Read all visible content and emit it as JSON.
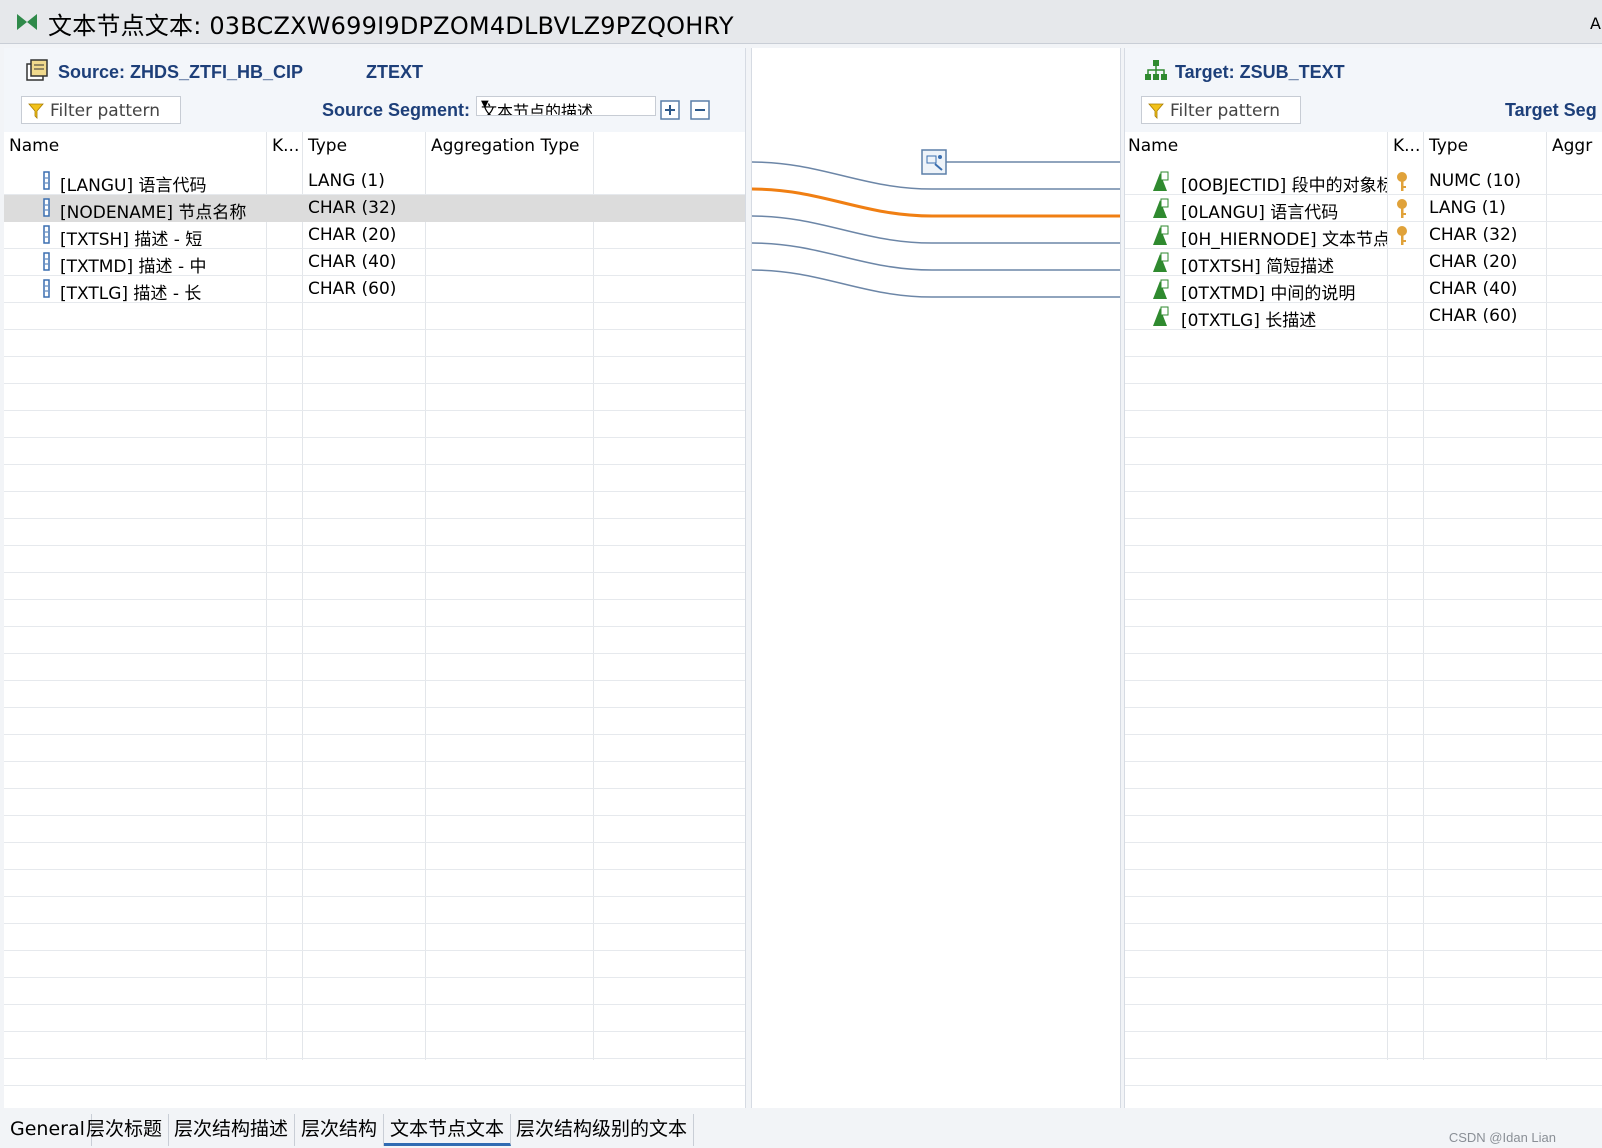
{
  "window": {
    "title": "文本节点文本: 03BCZXW699I9DPZOM4DLBVLZ9PZQOHRY",
    "right_cut_label": "A"
  },
  "source": {
    "title": "Source: ZHDS_ZTFI_HB_CIP",
    "segment_name": "ZTEXT",
    "filter_placeholder": "Filter pattern",
    "segment_label": "Source Segment:",
    "segment_value": "文本节点的描述",
    "columns": [
      "Name",
      "K...",
      "Type",
      "Aggregation Type"
    ],
    "rows": [
      {
        "name": "[LANGU] 语言代码",
        "key": "",
        "type": "LANG (1)",
        "agg": ""
      },
      {
        "name": "[NODENAME] 节点名称",
        "key": "",
        "type": "CHAR (32)",
        "agg": "",
        "selected": true
      },
      {
        "name": "[TXTSH] 描述 - 短",
        "key": "",
        "type": "CHAR (20)",
        "agg": ""
      },
      {
        "name": "[TXTMD] 描述 - 中",
        "key": "",
        "type": "CHAR (40)",
        "agg": ""
      },
      {
        "name": "[TXTLG] 描述 - 长",
        "key": "",
        "type": "CHAR (60)",
        "agg": ""
      }
    ]
  },
  "target": {
    "title": "Target: ZSUB_TEXT",
    "filter_placeholder": "Filter pattern",
    "segment_label": "Target Seg",
    "columns": [
      "Name",
      "K...",
      "Type",
      "Aggr"
    ],
    "rows": [
      {
        "name": "[0OBJECTID] 段中的对象标",
        "key": true,
        "type": "NUMC (10)"
      },
      {
        "name": "[0LANGU] 语言代码",
        "key": true,
        "type": "LANG (1)"
      },
      {
        "name": "[0H_HIERNODE] 文本节点",
        "key": true,
        "type": "CHAR (32)"
      },
      {
        "name": "[0TXTSH] 简短描述",
        "key": false,
        "type": "CHAR (20)"
      },
      {
        "name": "[0TXTMD] 中间的说明",
        "key": false,
        "type": "CHAR (40)"
      },
      {
        "name": "[0TXTLG] 长描述",
        "key": false,
        "type": "CHAR (60)"
      }
    ]
  },
  "mapping": {
    "line_color": "#6c86a7",
    "highlight_color": "#f07f13",
    "links": [
      {
        "from": "[LANGU] 语言代码",
        "to": "[0LANGU] 语言代码",
        "highlight": false
      },
      {
        "from": "[NODENAME] 节点名称",
        "to": "[0H_HIERNODE] 文本节点",
        "highlight": true
      },
      {
        "from": "[TXTSH] 描述 - 短",
        "to": "[0TXTSH] 简短描述",
        "highlight": false
      },
      {
        "from": "[TXTMD] 描述 - 中",
        "to": "[0TXTMD] 中间的说明",
        "highlight": false
      },
      {
        "from": "[TXTLG] 描述 - 长",
        "to": "[0TXTLG] 长描述",
        "highlight": false
      }
    ],
    "constant_rule_target": "[0OBJECTID] 段中的对象标",
    "rule_icon": "formula-rule-icon"
  },
  "tabs": [
    {
      "label": "General",
      "active": false
    },
    {
      "label": "层次标题",
      "active": false
    },
    {
      "label": "层次结构描述",
      "active": false
    },
    {
      "label": "层次结构",
      "active": false
    },
    {
      "label": "文本节点文本",
      "active": true
    },
    {
      "label": "层次结构级别的文本",
      "active": false
    }
  ],
  "watermark": "CSDN @Idan Lian",
  "colors": {
    "header_text": "#1d3f79",
    "selected_row": "#dcdcdc",
    "active_tab_underline": "#2f6bb3",
    "key_icon": "#e0a23a",
    "field_icon": "#2f8a2f"
  }
}
